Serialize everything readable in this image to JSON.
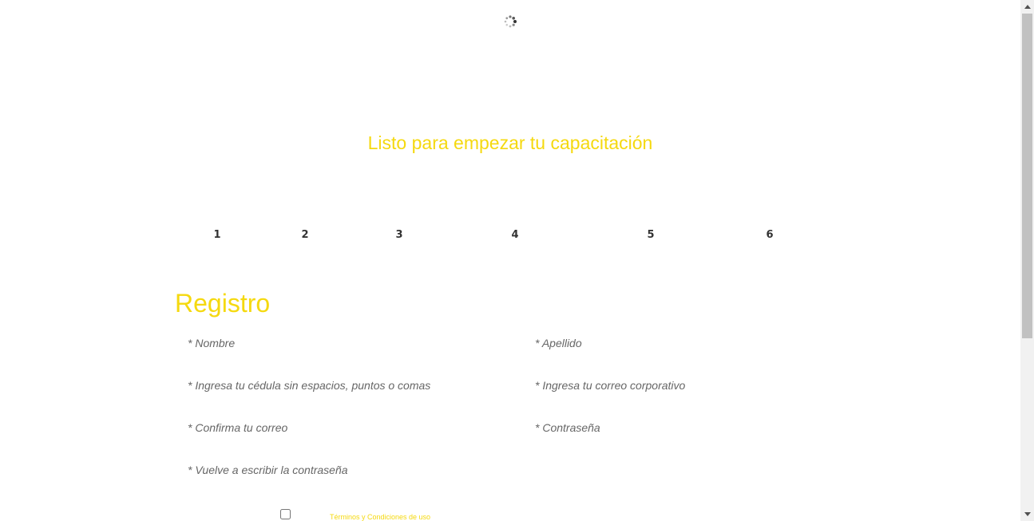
{
  "hero": {
    "title": "Listo para empezar tu capacitación"
  },
  "steps": [
    "1",
    "2",
    "3",
    "4",
    "5",
    "6"
  ],
  "form": {
    "title": "Registro",
    "fields": {
      "nombre": "* Nombre",
      "apellido": "* Apellido",
      "cedula": "* Ingresa tu cédula sin espacios, puntos o comas",
      "correo": "* Ingresa tu correo corporativo",
      "confirma_correo": "* Confirma tu correo",
      "contrasena": "* Contraseña",
      "repite_contrasena": "* Vuelve a escribir la contraseña"
    },
    "terms_label": "Términos y Condiciones de uso"
  },
  "colors": {
    "accent": "#f5d90f",
    "step_text": "#333333",
    "placeholder": "#666666"
  },
  "icons": {
    "spinner": "loading-spinner-icon",
    "scroll_up": "arrow-up-icon",
    "scroll_down": "arrow-down-icon"
  }
}
